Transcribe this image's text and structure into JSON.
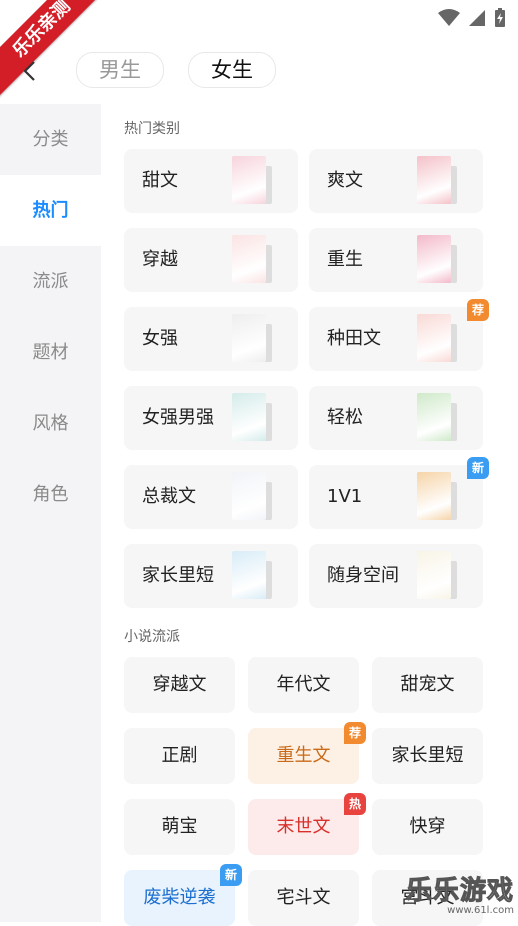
{
  "watermark_top": {
    "text": "乐乐亲测"
  },
  "header": {
    "tabs": [
      {
        "label": "男生",
        "active": false
      },
      {
        "label": "女生",
        "active": true
      }
    ]
  },
  "sidebar": {
    "items": [
      {
        "label": "分类",
        "active": false
      },
      {
        "label": "热门",
        "active": true
      },
      {
        "label": "流派",
        "active": false
      },
      {
        "label": "题材",
        "active": false
      },
      {
        "label": "风格",
        "active": false
      },
      {
        "label": "角色",
        "active": false
      }
    ]
  },
  "hot": {
    "title": "热门类别",
    "items": [
      {
        "label": "甜文",
        "cover_color": "#f7d4dc"
      },
      {
        "label": "爽文",
        "cover_color": "#f4c1c8"
      },
      {
        "label": "穿越",
        "cover_color": "#fbe3e3"
      },
      {
        "label": "重生",
        "cover_color": "#f3b9c9"
      },
      {
        "label": "女强",
        "cover_color": "#eeeeee"
      },
      {
        "label": "种田文",
        "cover_color": "#f9d9d5",
        "badge": "荐"
      },
      {
        "label": "女强男强",
        "cover_color": "#d4ecea"
      },
      {
        "label": "轻松",
        "cover_color": "#cfe9c9"
      },
      {
        "label": "总裁文",
        "cover_color": "#f1f4f8"
      },
      {
        "label": "1V1",
        "cover_color": "#f6d4a8",
        "badge": "新"
      },
      {
        "label": "家长里短",
        "cover_color": "#d8ecf7"
      },
      {
        "label": "随身空间",
        "cover_color": "#f8f4e6"
      }
    ]
  },
  "genre": {
    "title": "小说流派",
    "items": [
      {
        "label": "穿越文",
        "style": "plain"
      },
      {
        "label": "年代文",
        "style": "plain"
      },
      {
        "label": "甜宠文",
        "style": "plain"
      },
      {
        "label": "正剧",
        "style": "plain"
      },
      {
        "label": "重生文",
        "style": "orange",
        "badge": "荐"
      },
      {
        "label": "家长里短",
        "style": "plain"
      },
      {
        "label": "萌宝",
        "style": "plain"
      },
      {
        "label": "末世文",
        "style": "red",
        "badge": "热"
      },
      {
        "label": "快穿",
        "style": "plain"
      },
      {
        "label": "废柴逆袭",
        "style": "blue",
        "badge": "新"
      },
      {
        "label": "宅斗文",
        "style": "plain"
      },
      {
        "label": "宫斗文",
        "style": "plain"
      }
    ]
  },
  "watermark_bottom": {
    "title": "乐乐游戏",
    "url": "www.61l.com"
  }
}
